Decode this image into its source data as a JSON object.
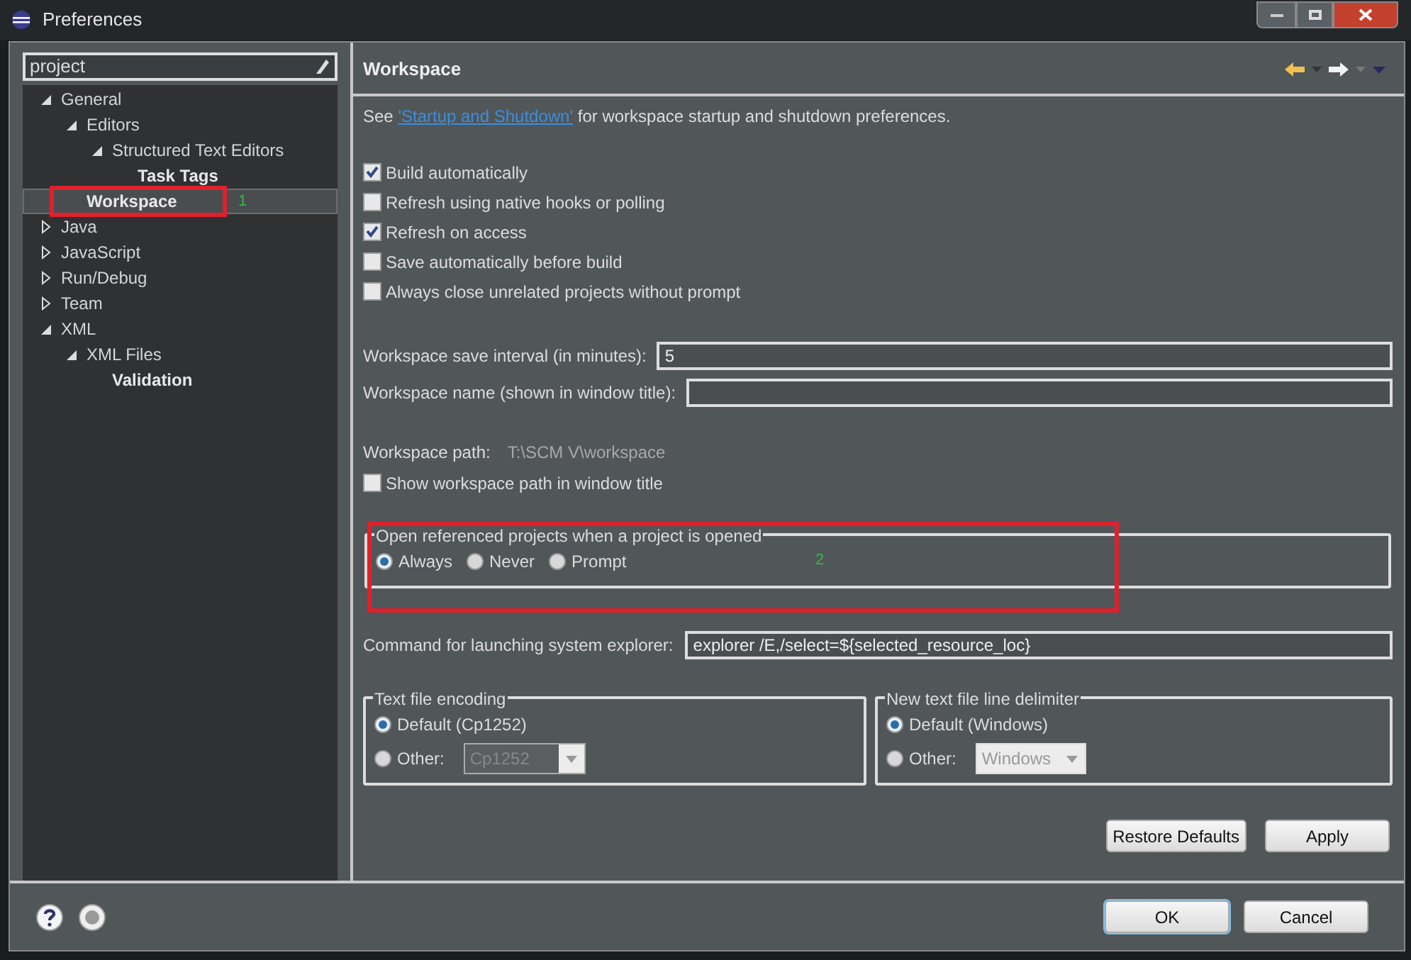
{
  "window": {
    "title": "Preferences"
  },
  "filter": {
    "value": "project"
  },
  "tree": [
    {
      "label": "General",
      "expanded": true,
      "match": false,
      "selected": false,
      "children": [
        {
          "label": "Editors",
          "expanded": true,
          "match": false,
          "selected": false,
          "children": [
            {
              "label": "Structured Text Editors",
              "expanded": true,
              "match": false,
              "selected": false,
              "children": [
                {
                  "label": "Task Tags",
                  "match": true,
                  "selected": false
                }
              ]
            }
          ]
        },
        {
          "label": "Workspace",
          "match": true,
          "selected": true
        }
      ]
    },
    {
      "label": "Java",
      "expanded": false,
      "match": false,
      "selected": false
    },
    {
      "label": "JavaScript",
      "expanded": false,
      "match": false,
      "selected": false
    },
    {
      "label": "Run/Debug",
      "expanded": false,
      "match": false,
      "selected": false
    },
    {
      "label": "Team",
      "expanded": false,
      "match": false,
      "selected": false
    },
    {
      "label": "XML",
      "expanded": true,
      "match": false,
      "selected": false,
      "children": [
        {
          "label": "XML Files",
          "expanded": true,
          "match": false,
          "selected": false,
          "children": [
            {
              "label": "Validation",
              "match": true,
              "selected": false
            }
          ]
        }
      ]
    }
  ],
  "page": {
    "title": "Workspace",
    "intro": {
      "before": "See",
      "link": "'Startup and Shutdown'",
      "after": "for workspace startup and shutdown preferences."
    },
    "checkboxes": [
      {
        "label": "Build automatically",
        "checked": true
      },
      {
        "label": "Refresh using native hooks or polling",
        "checked": false
      },
      {
        "label": "Refresh on access",
        "checked": true
      },
      {
        "label": "Save automatically before build",
        "checked": false
      },
      {
        "label": "Always close unrelated projects without prompt",
        "checked": false
      }
    ],
    "fields": [
      {
        "label": "Workspace save interval (in minutes):",
        "value": "5"
      },
      {
        "label": "Workspace name (shown in window title):"
      }
    ],
    "path": {
      "label": "Workspace path:",
      "value": "T:\\SCM V\\workspace"
    },
    "show_path": {
      "label": "Show workspace path in window title",
      "checked": false
    },
    "open_referenced": {
      "title": "Open referenced projects when a project is opened",
      "options": [
        {
          "label": "Always",
          "selected": true
        },
        {
          "label": "Never",
          "selected": false
        },
        {
          "label": "Prompt",
          "selected": false
        }
      ]
    },
    "explorer": {
      "label": "Command for launching system explorer:",
      "value": "explorer /E,/select=${selected_resource_loc}"
    },
    "encoding": {
      "title": "Text file encoding",
      "options": [
        {
          "label": "Default (Cp1252)",
          "selected": true
        },
        {
          "label": "Other:",
          "selected": false,
          "combo": "Cp1252"
        }
      ]
    },
    "delimiter": {
      "title": "New text file line delimiter",
      "options": [
        {
          "label": "Default (Windows)",
          "selected": true
        },
        {
          "label": "Other:",
          "selected": false,
          "combo": "Windows"
        }
      ]
    },
    "buttons": [
      "Restore Defaults",
      "Apply"
    ]
  },
  "annotations": [
    {
      "label": "1"
    },
    {
      "label": "2"
    }
  ],
  "dialog_buttons": [
    "OK",
    "Cancel"
  ]
}
